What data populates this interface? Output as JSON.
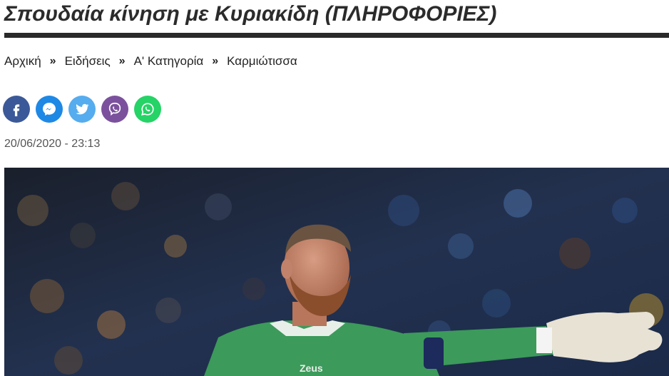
{
  "article": {
    "title": "Σπουδαία κίνηση με Κυριακίδη (ΠΛΗΡΟΦΟΡΙΕΣ)",
    "date": "20/06/2020 - 23:13"
  },
  "breadcrumb": {
    "separator": "»",
    "items": [
      "Αρχική",
      "Ειδήσεις",
      "Α' Κατηγορία",
      "Καρμιώτισσα"
    ]
  },
  "share": {
    "buttons": [
      {
        "icon": "facebook-icon",
        "color": "#3b5998"
      },
      {
        "icon": "messenger-icon",
        "color": "#1e88e5"
      },
      {
        "icon": "twitter-icon",
        "color": "#55acee"
      },
      {
        "icon": "viber-icon",
        "color": "#7b519d"
      },
      {
        "icon": "whatsapp-icon",
        "color": "#25d366"
      }
    ]
  },
  "photo": {
    "jersey_text": "Zeus",
    "colors": {
      "jersey": "#3c9a5b",
      "glove": "#e8e2d4",
      "stands": "#1c2a44"
    }
  }
}
